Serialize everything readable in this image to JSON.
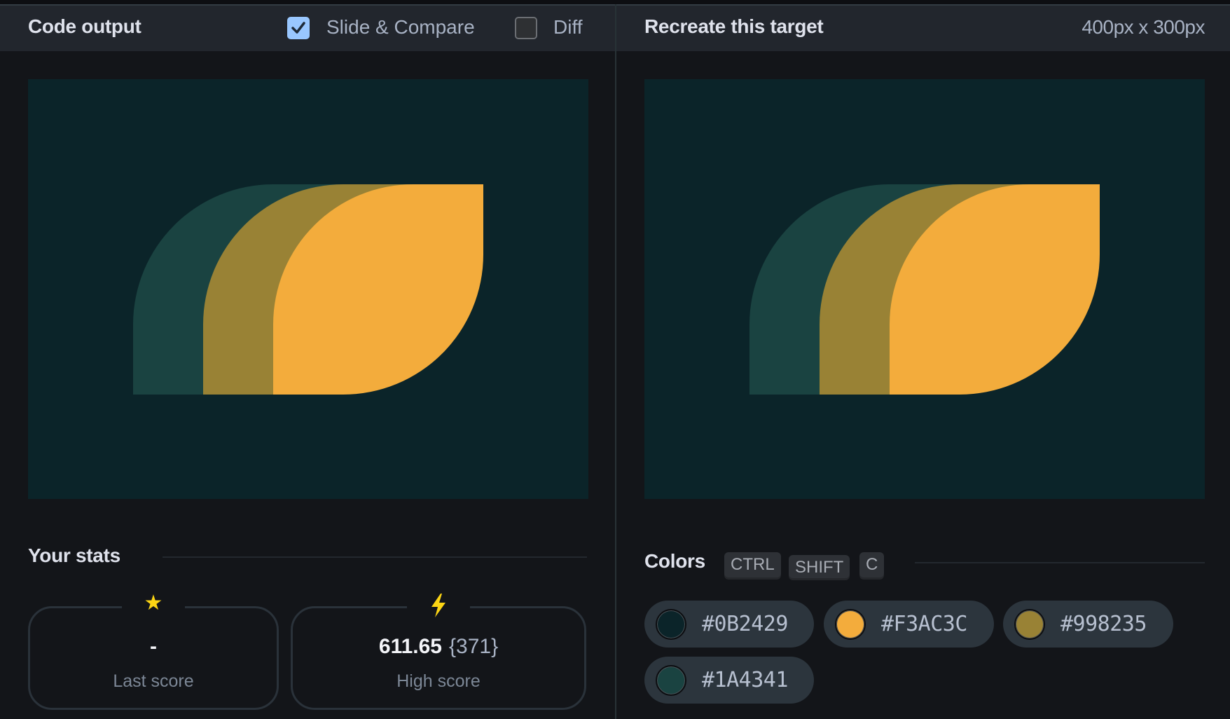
{
  "left_panel": {
    "title": "Code output",
    "slide_compare": {
      "label": "Slide & Compare",
      "checked": true
    },
    "diff": {
      "label": "Diff",
      "checked": false
    }
  },
  "right_panel": {
    "title": "Recreate this target",
    "size_label": "400px x 300px"
  },
  "canvas": {
    "background": "#0B2429",
    "shapes": [
      {
        "name": "teal-leaf",
        "color": "#1A4341"
      },
      {
        "name": "olive-leaf",
        "color": "#998235"
      },
      {
        "name": "orange-leaf",
        "color": "#F3AC3C"
      }
    ]
  },
  "stats": {
    "title": "Your stats",
    "last_score": {
      "icon": "star-icon",
      "glyph": "★",
      "value": "-",
      "label": "Last score"
    },
    "high_score": {
      "icon": "lightning-icon",
      "glyph": "⚡",
      "value": "611.65",
      "sub": "{371}",
      "label": "High score"
    }
  },
  "colors": {
    "title": "Colors",
    "shortcut": [
      "CTRL",
      "SHIFT",
      "C"
    ],
    "swatches": [
      {
        "hex": "#0B2429"
      },
      {
        "hex": "#F3AC3C"
      },
      {
        "hex": "#998235"
      },
      {
        "hex": "#1A4341"
      }
    ]
  }
}
